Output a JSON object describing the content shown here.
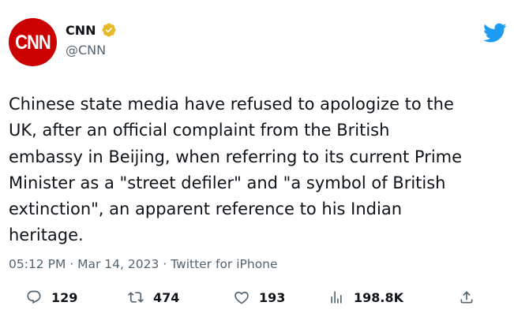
{
  "author": {
    "avatar_text": "CNN",
    "name": "CNN",
    "handle": "@CNN",
    "verified_color": "#e8b829"
  },
  "tweet": {
    "lines": [
      "Chinese state media have refused to apologize to the",
      "UK, after an official complaint from the British",
      "embassy in Beijing, when referring to its current Prime",
      "Minister as a \"street defiler\" and \"a symbol of British",
      "extinction\", an apparent reference to his Indian",
      "heritage."
    ]
  },
  "meta": {
    "time": "05:12 PM",
    "separator": " · ",
    "date": "Mar 14, 2023",
    "source": "Twitter for iPhone"
  },
  "actions": {
    "replies": "129",
    "retweets": "474",
    "likes": "193",
    "views": "198.8K"
  },
  "colors": {
    "brand_red": "#cc0000",
    "twitter_blue": "#1d9bf0",
    "secondary_text": "#536471",
    "icon_gray": "#536471"
  },
  "icons": [
    "verified-badge-icon",
    "twitter-bird-icon",
    "reply-icon",
    "retweet-icon",
    "like-icon",
    "views-icon",
    "share-icon"
  ]
}
